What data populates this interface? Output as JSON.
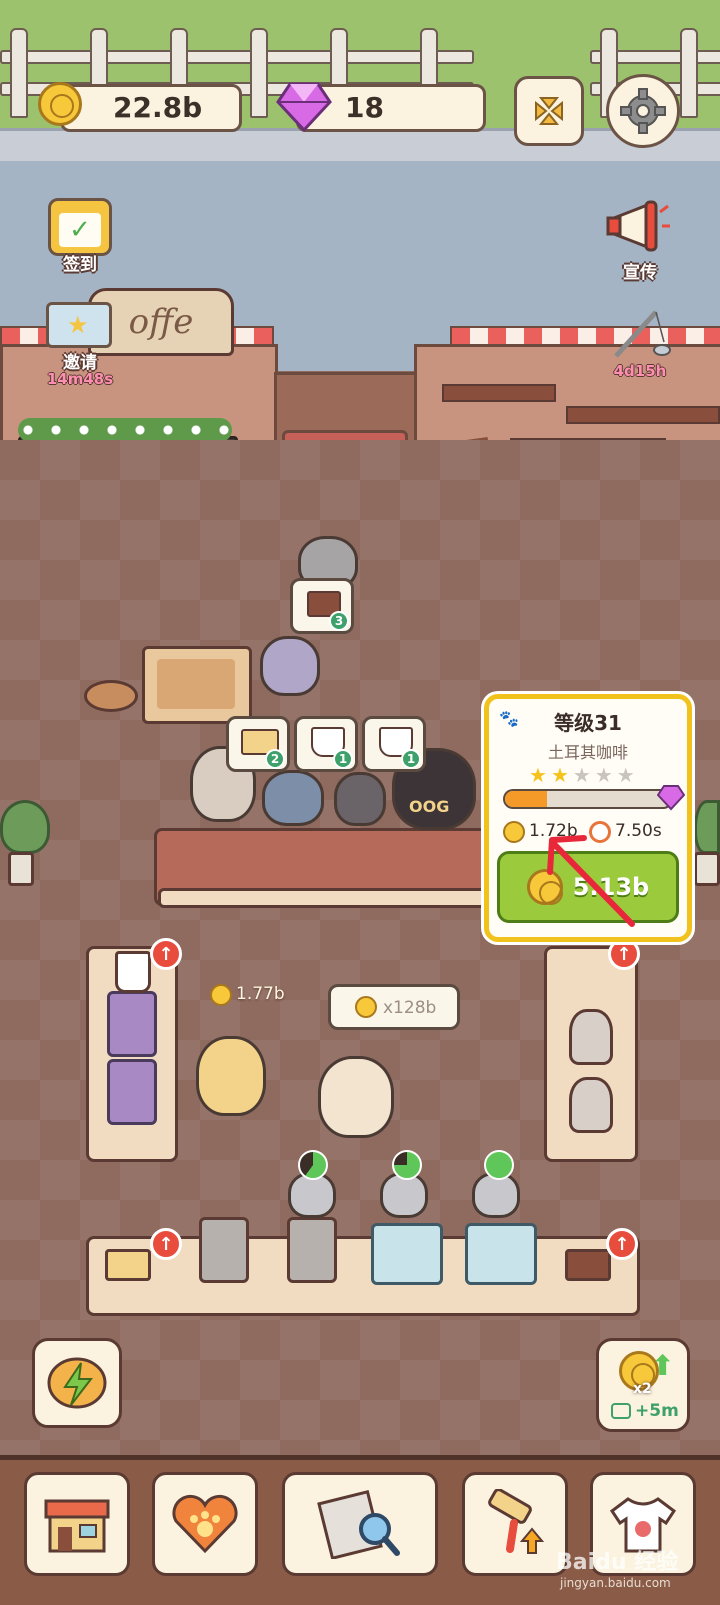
{
  "hud": {
    "coins": "22.8b",
    "gems": "18"
  },
  "side": {
    "checkin_label": "签到",
    "invite_label": "邀请",
    "invite_timer": "14m48s",
    "promo_label": "宣传",
    "fish_timer": "4d15h"
  },
  "storefront": {
    "sign_text": "offe"
  },
  "orders": [
    {
      "item": "cake-slice",
      "count": "3"
    },
    {
      "item": "sandwich",
      "count": "2"
    },
    {
      "item": "coffee-cup",
      "count": "1"
    },
    {
      "item": "coffee-cup",
      "count": "1"
    }
  ],
  "customer_shirt": "OOG",
  "float_income": "1.77b",
  "multiplier": "x128b",
  "panel": {
    "level": "等级31",
    "name": "土耳其咖啡",
    "stars_filled": 2,
    "stars_total": 5,
    "progress": 0.25,
    "income": "1.72b",
    "time": "7.50s",
    "upgrade_cost": "5.13b"
  },
  "boost": {
    "multiplier": "x2",
    "duration": "+5m"
  },
  "nav": [
    "shop",
    "pets",
    "search",
    "decorate",
    "outfits"
  ],
  "watermark": {
    "brand": "Baidu 经验",
    "url": "jingyan.baidu.com"
  },
  "colors": {
    "accent_gold": "#f1c21c",
    "buy_green": "#9bcb3c",
    "progress_orange": "#f59a28",
    "alert_red": "#e84c3d"
  }
}
